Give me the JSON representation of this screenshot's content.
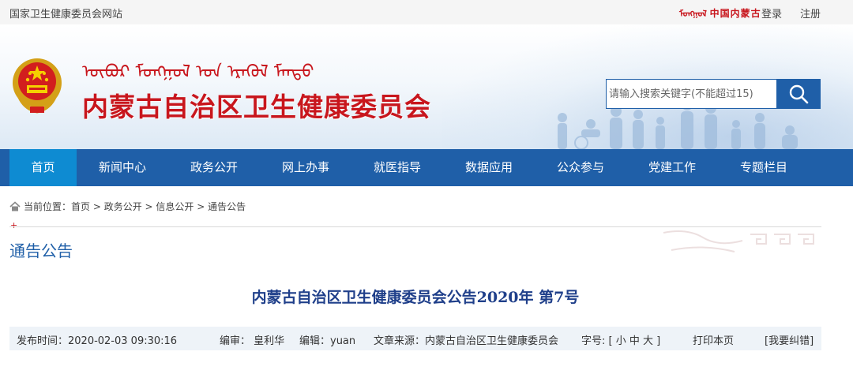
{
  "topbar": {
    "site_link": "国家卫生健康委员会网站",
    "mini_logo_mongol": "ᠮᠣᠩᠭᠣᠯ",
    "mini_logo_cn": "中国内蒙古",
    "login": "登录",
    "register": "注册"
  },
  "banner": {
    "mongol_title": "ᠥᠪᠥᠷ ᠮᠣᠩᠭᠣᠯ ᠤᠨ ᠡᠷᠡᠭᠦᠯ ᠮᠡᠨᠳᠦ",
    "org_title": "内蒙古自治区卫生健康委员会",
    "search_placeholder": "请输入搜索关键字(不能超过15)"
  },
  "nav": {
    "items": [
      {
        "label": "首页"
      },
      {
        "label": "新闻中心"
      },
      {
        "label": "政务公开"
      },
      {
        "label": "网上办事"
      },
      {
        "label": "就医指导"
      },
      {
        "label": "数据应用"
      },
      {
        "label": "公众参与"
      },
      {
        "label": "党建工作"
      },
      {
        "label": "专题栏目"
      }
    ]
  },
  "breadcrumb": {
    "prefix": "当前位置：",
    "items": [
      "首页",
      "政务公开",
      "信息公开",
      "通告公告"
    ],
    "sep": " > "
  },
  "section": {
    "plus": "+",
    "title": "通告公告"
  },
  "article": {
    "title": "内蒙古自治区卫生健康委员会公告2020年  第7号"
  },
  "info": {
    "publish_time": "发布时间：2020-02-03 09:30:16",
    "reviewer": "编审：  皇利华",
    "editor": "编辑：yuan",
    "source": "文章来源：内蒙古自治区卫生健康委员会",
    "font_size": "字号: [ 小 中 大 ]",
    "print": "打印本页",
    "report_error": "[我要纠错]"
  },
  "colors": {
    "primary_blue": "#1f5fa8",
    "active_blue": "#0e8bd2",
    "brand_red": "#c8161d"
  }
}
